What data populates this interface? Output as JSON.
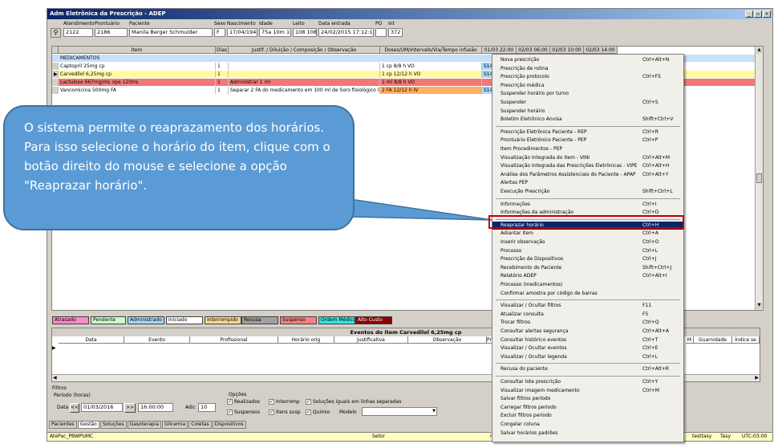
{
  "window": {
    "title": "Adm Eletrônica da Prescrição - ADEP",
    "buttons": [
      "_",
      "▫",
      "×"
    ]
  },
  "patient": {
    "labels": {
      "atendimento": "Atendimento",
      "prontuario": "Prontuário",
      "paciente": "Paciente",
      "sexo": "Sexo",
      "nascimento": "Nascimento",
      "idade": "Idade",
      "leito": "Leito",
      "data_entrada": "Data entrada",
      "po": "PO",
      "int": "Int"
    },
    "atendimento": "2122",
    "prontuario": "2186",
    "paciente": "Manila Berger Schmulder",
    "sexo": "F",
    "nascimento": "17/04/1940",
    "idade": "75a 10m 13",
    "leito": "108 108",
    "data_entrada": "24/02/2015 17:12:14",
    "po": "",
    "int": "372"
  },
  "grid": {
    "headers": [
      "Item",
      "Dias",
      "Justif. / Diluição / Composição / Observação",
      "Doses/UM/Intervalo/Via/Tempo infusão",
      "01/03 22:00",
      "02/03 06:00",
      "02/03 10:00",
      "02/03 14:00"
    ],
    "group": "MEDICAMENTOS",
    "rows": [
      {
        "item": "Captopril 25mg cp",
        "dias": "1",
        "obs": "",
        "dose": "1 cp   8/8 h   VO",
        "h1": "S1411",
        "h2": "",
        "color": "#ffffff"
      },
      {
        "item": "Carvedilol 6,25mg cp",
        "dias": "1",
        "obs": "",
        "dose": "1 cp   12/12 h   VO",
        "h1": "S1411",
        "h2": "",
        "color": "#fffaa0"
      },
      {
        "item": "Lactulose 667mg/mL xpe 120mL",
        "dias": "1",
        "obs": "Administrar 1 ml",
        "dose": "1 ml   8/8 h   VO",
        "h1": "",
        "h2": "",
        "color": "#f07878"
      },
      {
        "item": "Vancomicina 500mg FA",
        "dias": "1",
        "obs": "Separar 2 FA do medicamento em 100 ml de Soro fisiológico 0,9%",
        "dose": "2 FA   12/12 h   IV",
        "h1": "S1411",
        "h2": "",
        "color": "#ffffff"
      }
    ]
  },
  "legend": [
    {
      "label": "Atrasado",
      "color": "#ff8ac8"
    },
    {
      "label": "Pendente",
      "color": "#c8ffc8"
    },
    {
      "label": "Administrado",
      "color": "#a8d8ff"
    },
    {
      "label": "Iniciado",
      "color": "#ffffff"
    },
    {
      "label": "Interrompido",
      "color": "#ffd890"
    },
    {
      "label": "Recusa",
      "color": "#a0a0a0"
    },
    {
      "label": "Suspenso",
      "color": "#ff8080"
    },
    {
      "label": "Ordem Médica",
      "color": "#40e0e0"
    },
    {
      "label": "Alto Custo",
      "color": "#8b0000"
    }
  ],
  "events": {
    "title": "Eventos do item Carvedilol 6,25mg cp",
    "headers": [
      "Data",
      "Evento",
      "Profissional",
      "Horário orig",
      "Justificativa",
      "Observação",
      "Pres",
      "M",
      "Guarnidade",
      "Índice se"
    ]
  },
  "filters": {
    "title": "Filtros",
    "period": "Período (horas)",
    "data_label": "Data",
    "date": "01/03/2016",
    "time": "16:00:00",
    "add_label": "Adic",
    "add_value": "10",
    "options_title": "Opções",
    "opts": [
      "Realizados",
      "Interromp",
      "Soluções iguais em linhas separadas",
      "Suspensos",
      "Itens susp",
      "Quimio"
    ],
    "modelo": "Modelo"
  },
  "tabs": [
    "Pacientes",
    "Gestão",
    "Soluções",
    "Gasoterapia",
    "Glicemia",
    "Coletas",
    "Dispositivos"
  ],
  "status": {
    "left": "AtePac_PBWPUMC",
    "mid": "Setor",
    "m": "m",
    "u1": "testtasy",
    "u2": "Tasy",
    "tz": "UTC-03:00"
  },
  "callout": {
    "line1": "O sistema permite o reaprazamento dos horários.",
    "line2": "Para isso selecione o horário do item, clique com o botão direito do mouse e selecione a opção \"Reaprazar horário\"."
  },
  "menu": [
    {
      "t": "Nova prescrição",
      "k": "Ctrl+Alt+N"
    },
    {
      "t": "Prescrição de rotina",
      "k": ""
    },
    {
      "t": "Prescrição protocolo",
      "k": "Ctrl+F5"
    },
    {
      "t": "Prescrição médica",
      "k": ""
    },
    {
      "t": "Suspender horário por turno",
      "k": ""
    },
    {
      "t": "Suspender",
      "k": "Ctrl+S"
    },
    {
      "t": "Suspender horário",
      "k": ""
    },
    {
      "t": "Boletim Eletrônico Anvisa",
      "k": "Shift+Ctrl+V"
    },
    {
      "sep": true
    },
    {
      "t": "Prescrição Eletrônica Paciente - REP",
      "k": "Ctrl+R"
    },
    {
      "t": "Prontuário Eletrônico Paciente - PEP",
      "k": "Ctrl+P"
    },
    {
      "t": "Item Procedimentos - PEP",
      "k": ""
    },
    {
      "t": "Visualização Integrada do Item - VINI",
      "k": "Ctrl+Alt+M"
    },
    {
      "t": "Visualização Integrada das Prescrições Eletrônicas - VIPE",
      "k": "Ctrl+Alt+H"
    },
    {
      "t": "Análise dos Parâmetros Assistenciais do Paciente - APAP",
      "k": "Ctrl+Alt+Y"
    },
    {
      "t": "Alertas PEP",
      "k": ""
    },
    {
      "t": "Execução Prescrição",
      "k": "Shift+Ctrl+L"
    },
    {
      "sep": true
    },
    {
      "t": "Informações",
      "k": "Ctrl+I"
    },
    {
      "t": "Informações da administração",
      "k": "Ctrl+D"
    },
    {
      "sep": true
    },
    {
      "t": "Reaprazar horário",
      "k": "Ctrl+H",
      "hl": true
    },
    {
      "t": "Adiantar item",
      "k": "Ctrl+A"
    },
    {
      "t": "Inserir observação",
      "k": "Ctrl+O"
    },
    {
      "t": "Processo",
      "k": "Ctrl+L"
    },
    {
      "t": "Prescrição de Dispositivos",
      "k": "Ctrl+J"
    },
    {
      "t": "Recebimento do Paciente",
      "k": "Shift+Ctrl+J"
    },
    {
      "t": "Relatório ADEP",
      "k": "Ctrl+Alt+I"
    },
    {
      "t": "Processo (medicamentos)",
      "k": ""
    },
    {
      "t": "Confirmar amostra por código de barras",
      "k": ""
    },
    {
      "sep": true
    },
    {
      "t": "Visualizar / Ocultar filtros",
      "k": "F11"
    },
    {
      "t": "Atualizar consulta",
      "k": "F5"
    },
    {
      "t": "Trocar filtros",
      "k": "Ctrl+Q"
    },
    {
      "t": "Consultar alertas segurança",
      "k": "Ctrl+Alt+A"
    },
    {
      "t": "Consultar histórico eventos",
      "k": "Ctrl+T"
    },
    {
      "t": "Visualizar / Ocultar eventos",
      "k": "Ctrl+E"
    },
    {
      "t": "Visualizar / Ocultar legenda",
      "k": "Ctrl+L"
    },
    {
      "sep": true
    },
    {
      "t": "Recusa do paciente",
      "k": "Ctrl+Alt+R"
    },
    {
      "sep": true
    },
    {
      "t": "Consultar lote prescrição",
      "k": "Ctrl+Y"
    },
    {
      "t": "Visualizar imagem medicamento",
      "k": "Ctrl+M"
    },
    {
      "t": "Salvar filtros período",
      "k": ""
    },
    {
      "t": "Carregar filtros período",
      "k": ""
    },
    {
      "t": "Excluir filtros período",
      "k": ""
    },
    {
      "t": "Congelar coluna",
      "k": ""
    },
    {
      "t": "Salvar horários padrões",
      "k": ""
    }
  ]
}
